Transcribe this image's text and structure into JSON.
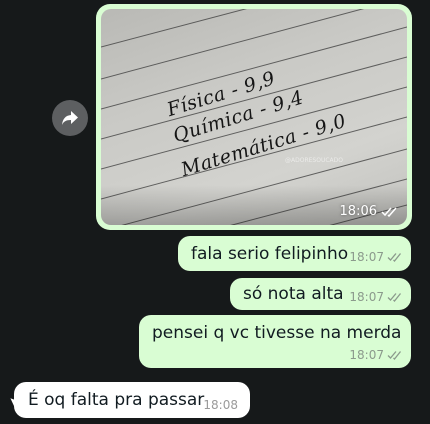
{
  "colors": {
    "background": "#16191a",
    "outgoing_bubble": "#d9fdd3",
    "incoming_bubble": "#ffffff",
    "forward_button": "#5d5f61",
    "meta_text": "#8b9a8c"
  },
  "forward_button": {
    "icon": "forward-arrow-icon"
  },
  "image_message": {
    "photo_text": {
      "line1": "Física - 9,9",
      "line2": "Química - 9,4",
      "line3": "Matemática - 9,0",
      "watermark": "@ADORESOUCADO"
    },
    "time": "18:06",
    "status_icon": "read-ticks-icon"
  },
  "messages": [
    {
      "direction": "outgoing",
      "text": "fala serio felipinho",
      "time": "18:07",
      "status_icon": "read-ticks-icon"
    },
    {
      "direction": "outgoing",
      "text": "só nota alta",
      "time": "18:07",
      "status_icon": "read-ticks-icon"
    },
    {
      "direction": "outgoing",
      "text": "pensei q vc tivesse na merda",
      "time": "18:07",
      "status_icon": "read-ticks-icon"
    },
    {
      "direction": "incoming",
      "text": "É oq falta pra passar",
      "time": "18:08"
    }
  ]
}
